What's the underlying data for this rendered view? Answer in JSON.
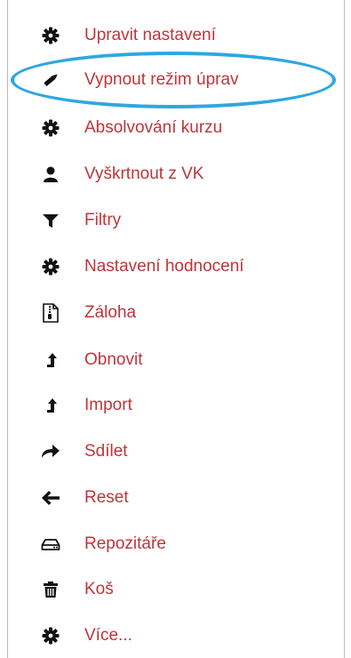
{
  "menu": {
    "items": [
      {
        "label": "Upravit nastavení",
        "icon": "gear-icon"
      },
      {
        "label": "Vypnout režim úprav",
        "icon": "pencil-icon"
      },
      {
        "label": "Absolvování kurzu",
        "icon": "gear-icon"
      },
      {
        "label": "Vyškrtnout z VK",
        "icon": "user-icon"
      },
      {
        "label": "Filtry",
        "icon": "filter-icon"
      },
      {
        "label": "Nastavení hodnocení",
        "icon": "gear-icon"
      },
      {
        "label": "Záloha",
        "icon": "archive-file-icon"
      },
      {
        "label": "Obnovit",
        "icon": "upload-arrow-icon"
      },
      {
        "label": "Import",
        "icon": "upload-arrow-icon"
      },
      {
        "label": "Sdílet",
        "icon": "share-arrow-icon"
      },
      {
        "label": "Reset",
        "icon": "arrow-left-icon"
      },
      {
        "label": "Repozitáře",
        "icon": "drive-icon"
      },
      {
        "label": "Koš",
        "icon": "trash-icon"
      },
      {
        "label": "Více...",
        "icon": "gear-icon"
      }
    ]
  },
  "colors": {
    "link": "#c0343a",
    "icon": "#111111",
    "highlight": "#2ea7e0",
    "border": "#bdbdbd"
  }
}
